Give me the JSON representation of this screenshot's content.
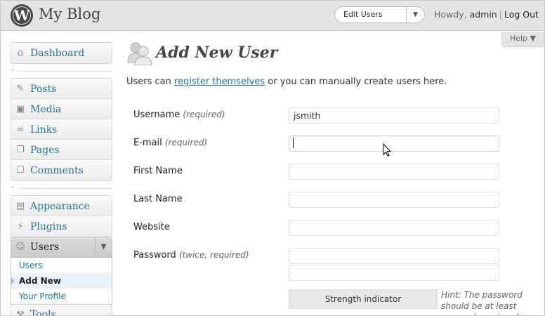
{
  "header": {
    "logo_glyph": "W",
    "site_title": "My Blog",
    "favorite_action": "Edit Users",
    "favorite_toggle": "▼",
    "howdy": "Howdy,",
    "username": "admin",
    "separator": "|",
    "logout": "Log Out"
  },
  "help": {
    "label": "Help ▼"
  },
  "menu": {
    "dashboard": {
      "label": "Dashboard",
      "icon": "⌂"
    },
    "collapse_arrow": "«",
    "posts": {
      "label": "Posts",
      "icon": "✎"
    },
    "media": {
      "label": "Media",
      "icon": "▣"
    },
    "links": {
      "label": "Links",
      "icon": "∞"
    },
    "pages": {
      "label": "Pages",
      "icon": "❐"
    },
    "comments": {
      "label": "Comments",
      "icon": "☐"
    },
    "appearance": {
      "label": "Appearance",
      "icon": "▤"
    },
    "plugins": {
      "label": "Plugins",
      "icon": "⚡"
    },
    "users": {
      "label": "Users",
      "icon": "☺",
      "toggle": "▼"
    },
    "users_sub": [
      "Users",
      "Add New",
      "Your Profile"
    ],
    "tools": {
      "label": "Tools",
      "icon": "⚒"
    }
  },
  "page": {
    "title": "Add New User",
    "intro_before": "Users can ",
    "intro_link": "register themselves",
    "intro_after": " or you can manually create users here."
  },
  "form": {
    "username_label": "Username",
    "username_note": "(required)",
    "username_value": "jsmith",
    "email_label": "E-mail",
    "email_note": "(required)",
    "email_value": "",
    "first_name_label": "First Name",
    "first_name_value": "",
    "last_name_label": "Last Name",
    "last_name_value": "",
    "website_label": "Website",
    "website_value": "",
    "password_label": "Password",
    "password_note": "(twice, required)",
    "strength_indicator": "Strength indicator",
    "hint": "Hint: The password should be at least seven characters long."
  },
  "colors": {
    "link": "#21759b",
    "header_bg": "#e4e4e4"
  }
}
